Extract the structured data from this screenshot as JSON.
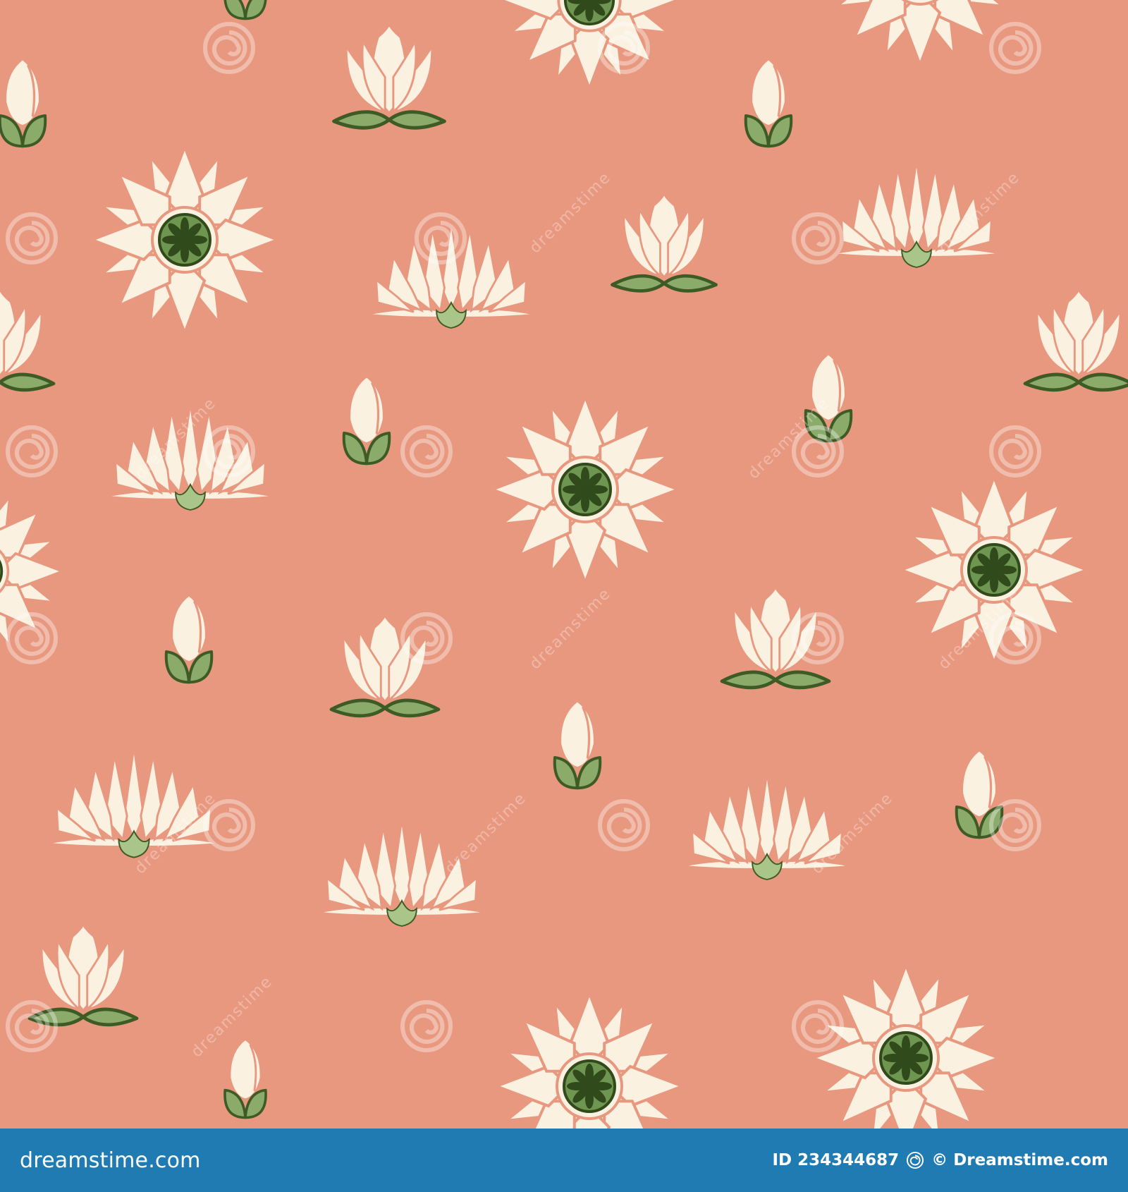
{
  "colors": {
    "background": "#e99880",
    "petal": "#fbf1e1",
    "petal_outline": "#e99880",
    "leaf_light": "#8bab6a",
    "leaf_dark": "#3e5a25",
    "center_light": "#6f9650",
    "center_dark": "#304a1c",
    "bud_base": "#a9c688",
    "footer_bg": "#1f7bb1",
    "watermark": "#ffffff"
  },
  "pattern": {
    "motifs": [
      "water-lily-top-view",
      "lotus-side-view",
      "lotus-bud",
      "tulip-shaped-bud"
    ]
  },
  "watermark": {
    "text": "dreamstime",
    "icon": "spiral-icon"
  },
  "footer": {
    "site": "dreamstime.com",
    "id_label": "ID 234344687",
    "copyright": "© Dreamstime.com",
    "logo_icon": "dreamstime-spiral-logo-icon"
  }
}
